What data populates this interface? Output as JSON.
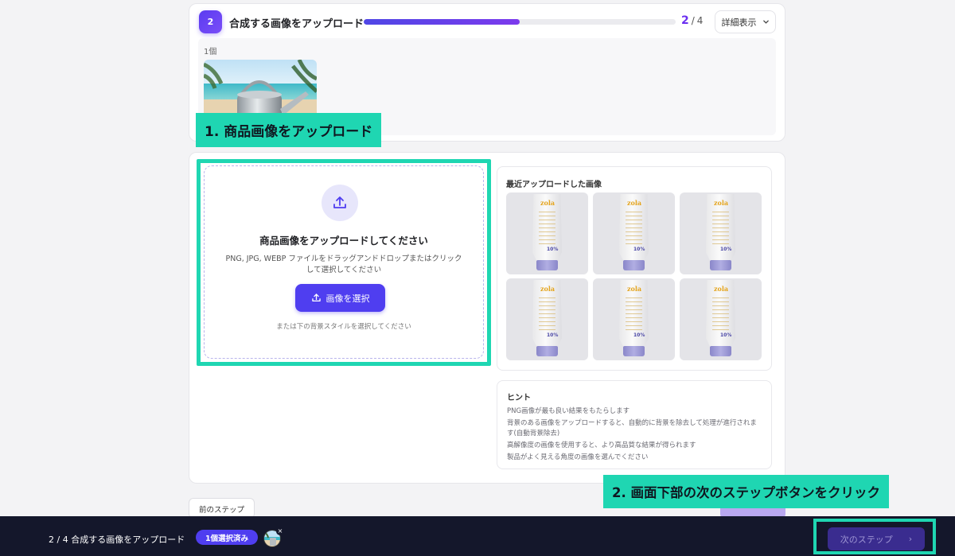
{
  "step": {
    "number": "2",
    "title": "合成する画像をアップロード",
    "progress_fraction": 0.5,
    "current": "2",
    "separator": "/",
    "total": "4",
    "details_label": "詳細表示",
    "uploaded_count": "1個"
  },
  "upload": {
    "title": "商品画像をアップロードしてください",
    "description": "PNG, JPG, WEBP ファイルをドラッグアンドドロップまたはクリックして選択してください",
    "select_button": "画像を選択",
    "alt_text": "または下の背景スタイルを選択してください"
  },
  "recent": {
    "title": "最近アップロードした画像",
    "items": [
      {
        "logo": "zola",
        "badge": "10%"
      },
      {
        "logo": "zola",
        "badge": "10%"
      },
      {
        "logo": "zola",
        "badge": "10%"
      },
      {
        "logo": "zola",
        "badge": "10%"
      },
      {
        "logo": "zola",
        "badge": "10%"
      },
      {
        "logo": "zola",
        "badge": "10%"
      }
    ]
  },
  "hints": {
    "title": "ヒント",
    "items": [
      "PNG画像が最も良い結果をもたらします",
      "背景のある画像をアップロードすると、自動的に背景を除去して処理が進行されます(自動背景除去)",
      "高解像度の画像を使用すると、より高品質な結果が得られます",
      "製品がよく見える角度の画像を選んでください"
    ]
  },
  "annotations": {
    "callout_1": "1. 商品画像をアップロード",
    "callout_2": "2. 画面下部の次のステップボタンをクリック"
  },
  "nav": {
    "prev_label": "前のステップ"
  },
  "footer": {
    "status": "2 / 4 合成する画像をアップロード",
    "selected_badge": "1個選択済み",
    "remove_symbol": "×",
    "next_label": "次のステップ",
    "next_chevron": "›"
  },
  "colors": {
    "accent": "#4f3ef0",
    "annotation": "#1fd6b2",
    "footer_bg": "#14172b"
  }
}
